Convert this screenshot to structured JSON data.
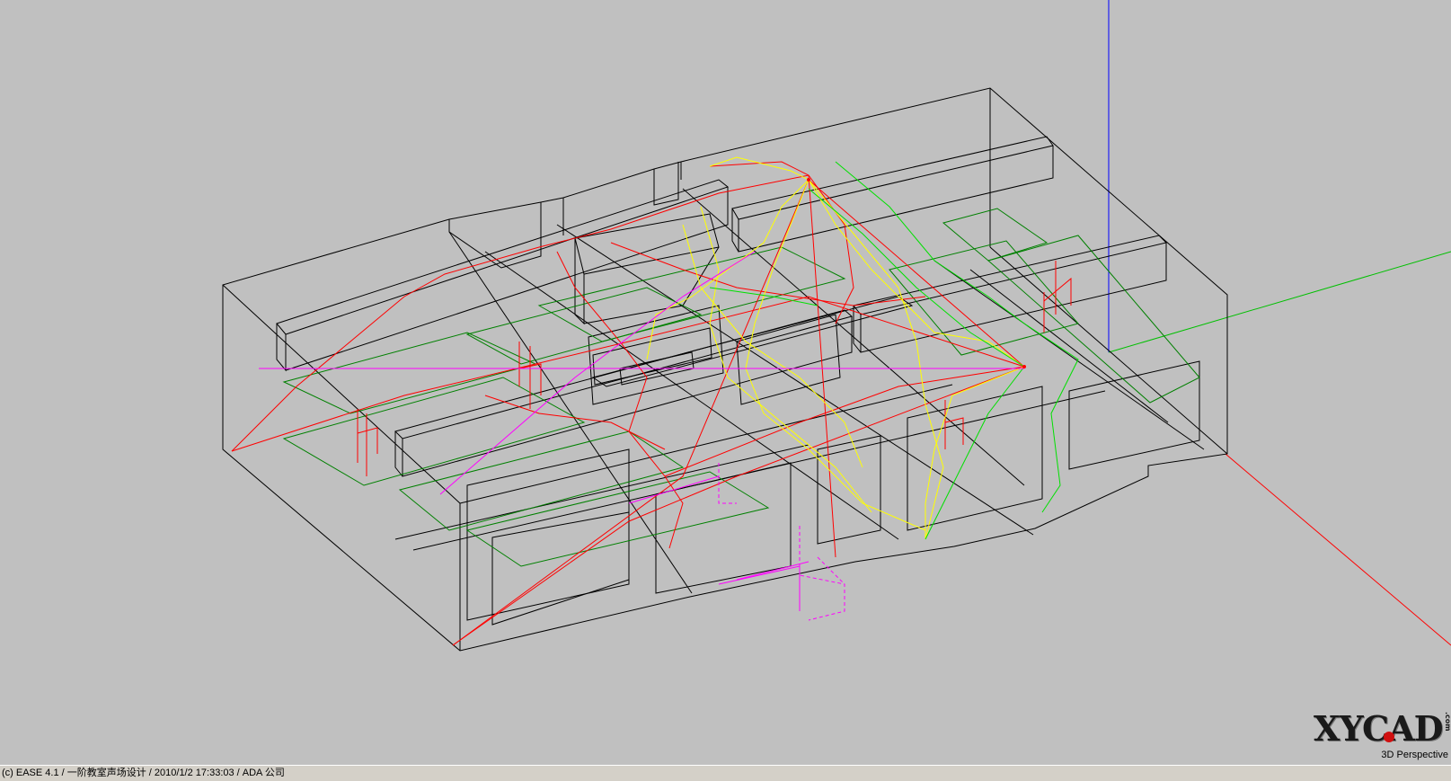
{
  "status_bar": {
    "text": "(c) EASE 4.1  / 一阶教室声场设计  / 2010/1/2 17:33:03 / ADA 公司"
  },
  "viewport": {
    "view_mode": "3D Perspective",
    "background_color": "#c0c0c0",
    "colors": {
      "room_wireframe": "#000000",
      "floor_areas": "#008000",
      "ray_paths_red": "#ff0000",
      "ray_paths_yellow": "#ffff00",
      "ray_paths_green": "#00e000",
      "source_magenta": "#ff00ff",
      "axis_x": "#ff0000",
      "axis_y": "#00c000",
      "axis_z": "#0000ff"
    }
  },
  "logo": {
    "text": "XYCAD",
    "suffix": ".com"
  }
}
